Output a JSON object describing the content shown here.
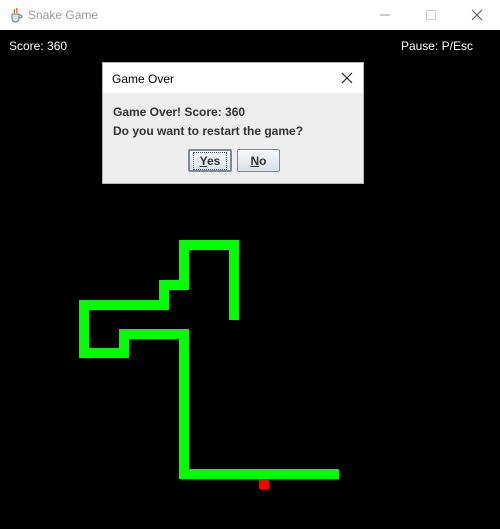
{
  "window": {
    "title": "Snake Game",
    "icon": "java-cup-icon"
  },
  "hud": {
    "score_text": "Score: 360",
    "pause_text": "Pause: P/Esc"
  },
  "game": {
    "background": "#000000",
    "snake_color": "#00ff00",
    "food_color": "#ff0000"
  },
  "dialog": {
    "title": "Game Over",
    "message_line1": "Game Over! Score: 360",
    "message_line2": "Do you want to restart the game?",
    "yes_mnemonic": "Y",
    "yes_rest": "es",
    "no_mnemonic": "N",
    "no_rest": "o"
  }
}
